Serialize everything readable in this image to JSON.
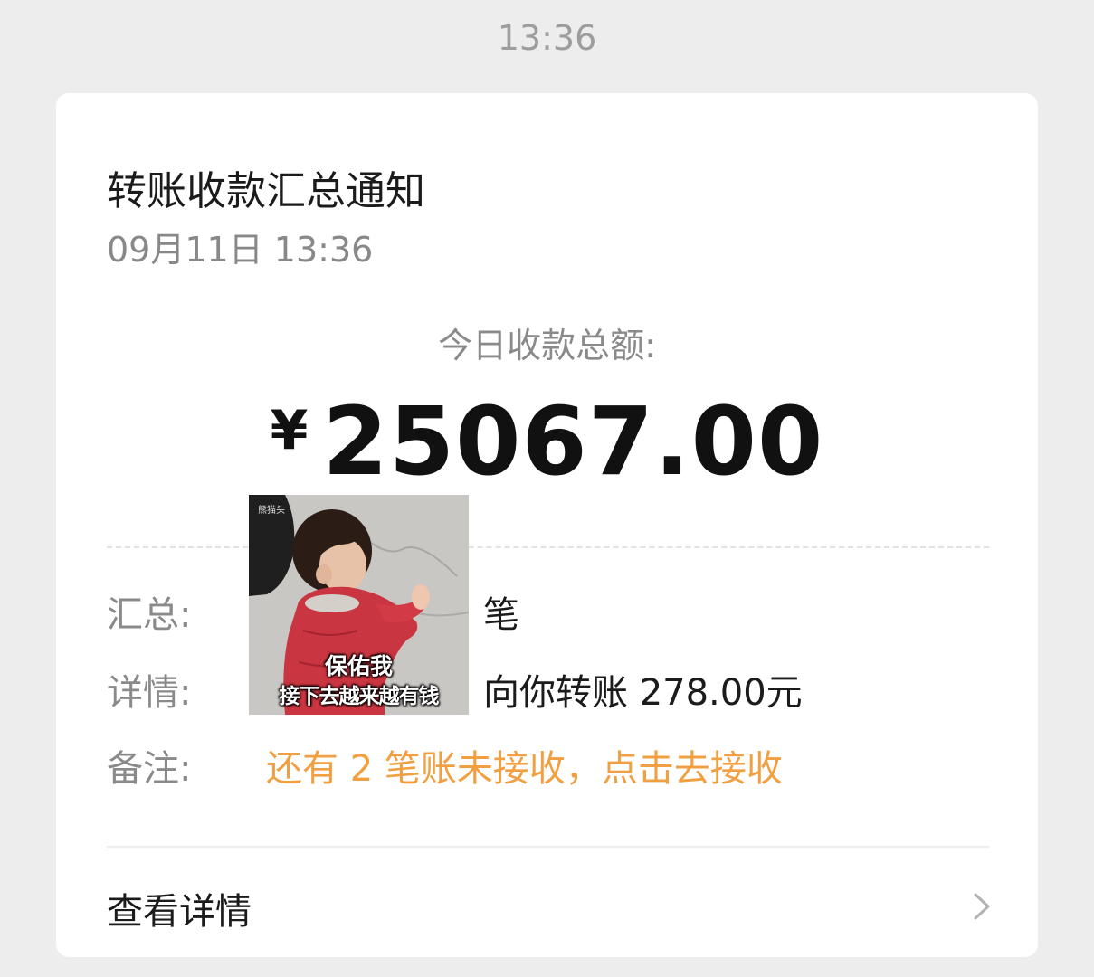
{
  "status_time": "13:36",
  "card": {
    "title": "转账收款汇总通知",
    "date": "09月11日 13:36",
    "sum_label": "今日收款总额:",
    "currency": "¥",
    "amount": "25067.00",
    "rows": [
      {
        "label": "汇总:",
        "value": "　　　　　　笔"
      },
      {
        "label": "详情:",
        "value": "　　　　　　向你转账 278.00元"
      },
      {
        "label": "备注:",
        "value": "还有 2 笔账未接收，点击去接收"
      }
    ],
    "view_details": "查看详情",
    "colors": {
      "warning": "#f0a042",
      "background": "#ededed"
    }
  },
  "sticker": {
    "caption_line1": "保佑我",
    "caption_line2": "接下去越来越有钱",
    "watermark": "熊猫头"
  }
}
